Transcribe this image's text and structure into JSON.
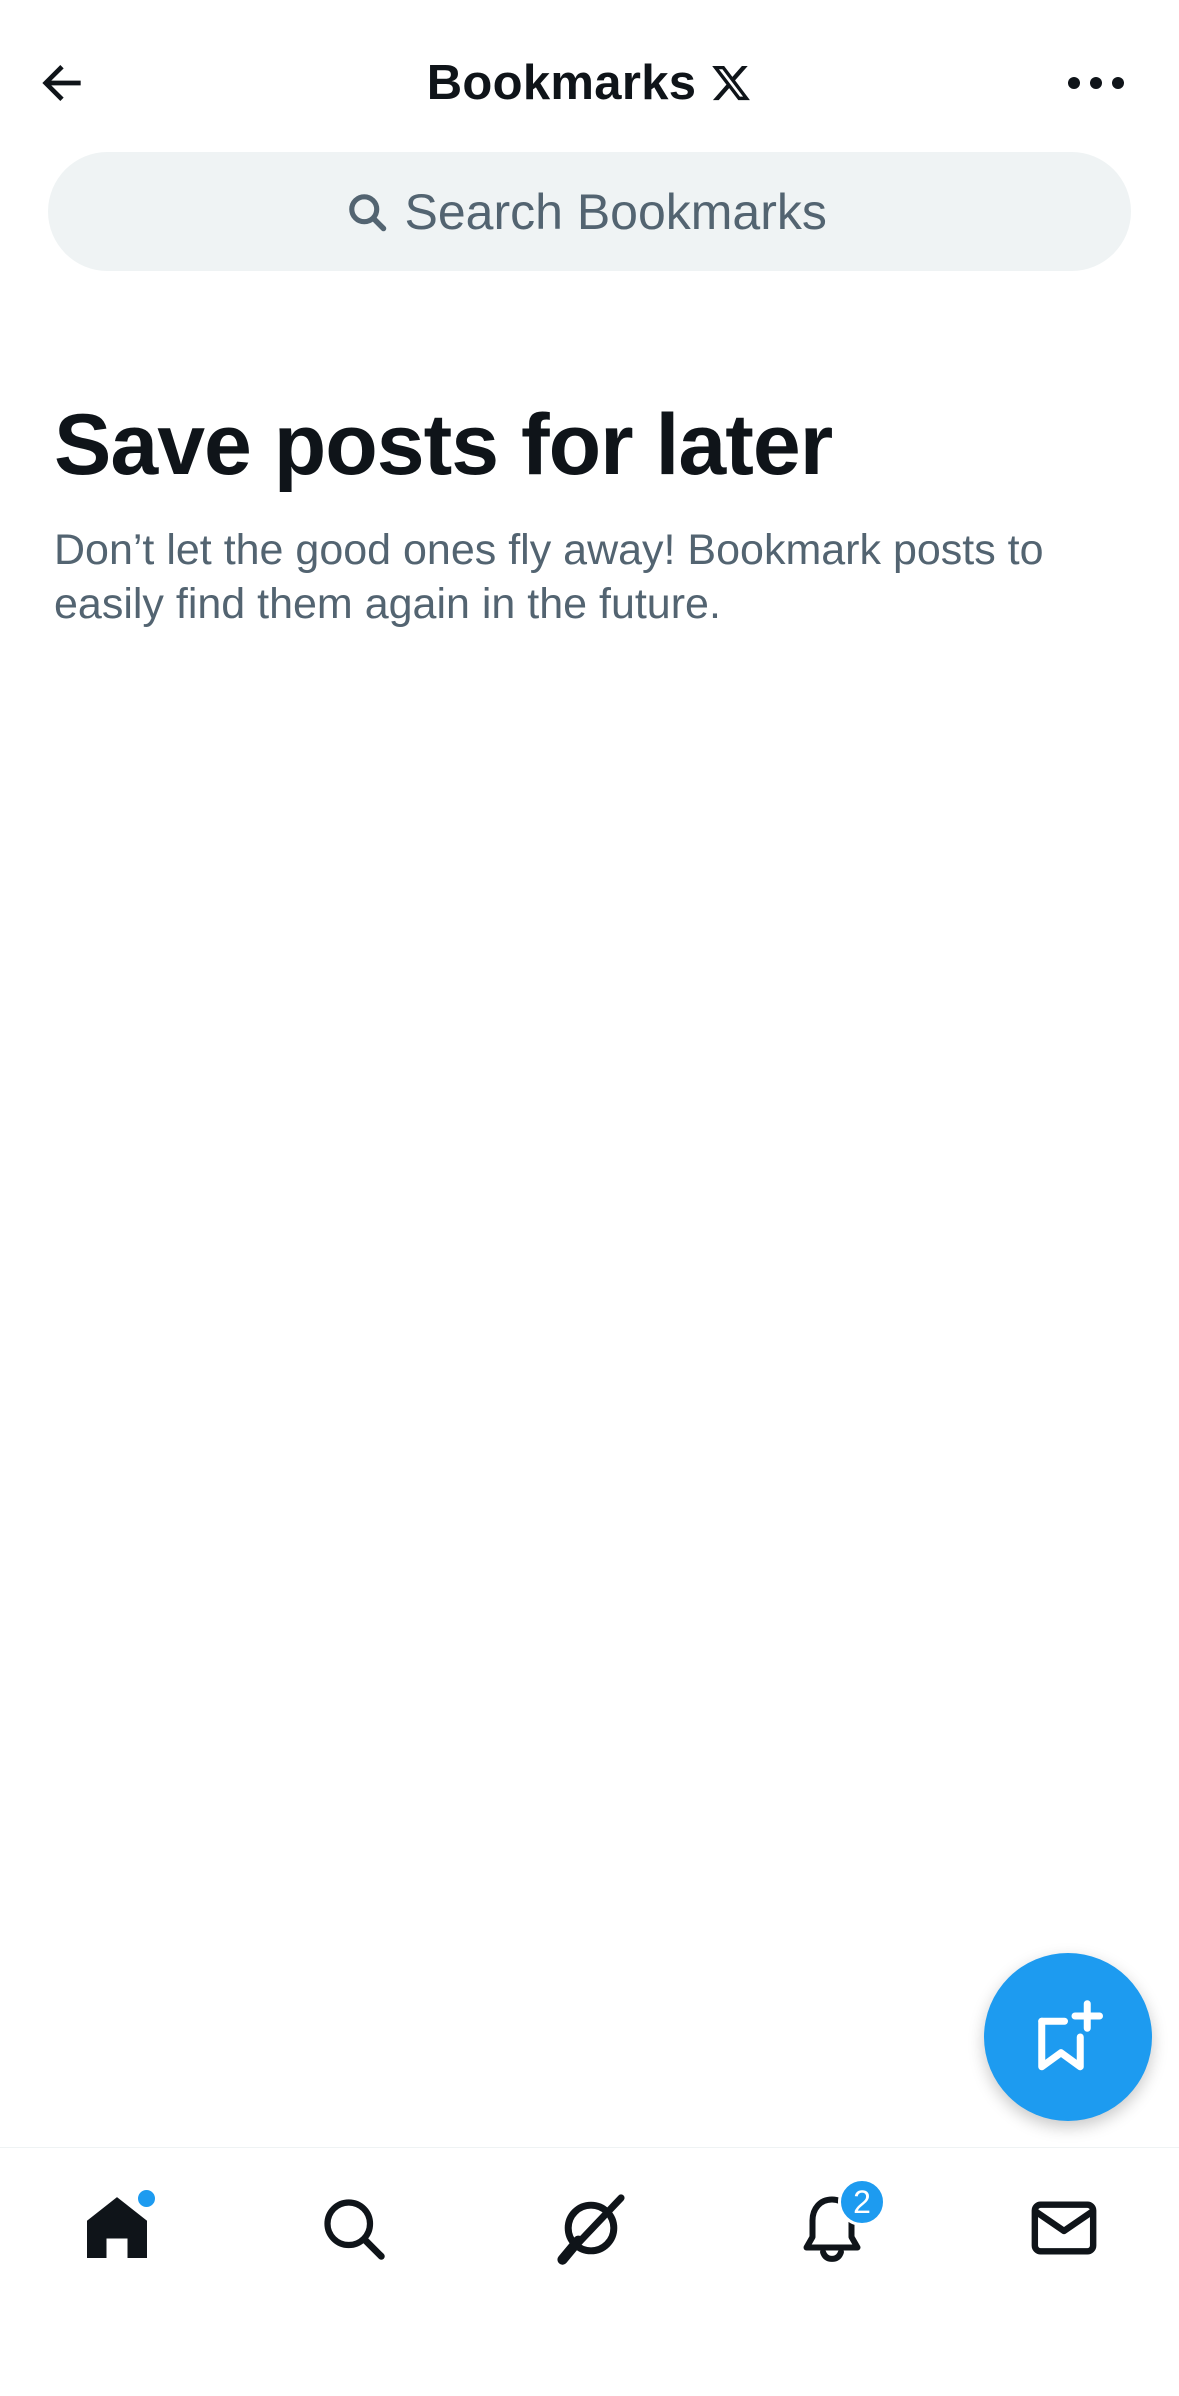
{
  "header": {
    "title": "Bookmarks",
    "back_icon": "arrow-left-icon",
    "logo_icon": "x-logo-icon",
    "more_icon": "more-horizontal-icon"
  },
  "search": {
    "placeholder": "Search Bookmarks",
    "value": "",
    "icon": "search-icon"
  },
  "empty_state": {
    "title": "Save posts for later",
    "description": "Don’t let the good ones fly away! Bookmark posts to easily find them again in the future."
  },
  "fab": {
    "icon": "bookmark-add-icon",
    "color": "#1d9bf0"
  },
  "bottom_nav": {
    "items": [
      {
        "name": "home",
        "icon": "home-icon",
        "active": true,
        "has_dot": true
      },
      {
        "name": "explore",
        "icon": "search-icon"
      },
      {
        "name": "grok",
        "icon": "grok-icon"
      },
      {
        "name": "notifications",
        "icon": "bell-icon",
        "badge": "2"
      },
      {
        "name": "messages",
        "icon": "mail-icon"
      }
    ]
  },
  "colors": {
    "accent": "#1d9bf0",
    "text_primary": "#0f1419",
    "text_secondary": "#536471",
    "search_bg": "#eff3f4"
  }
}
